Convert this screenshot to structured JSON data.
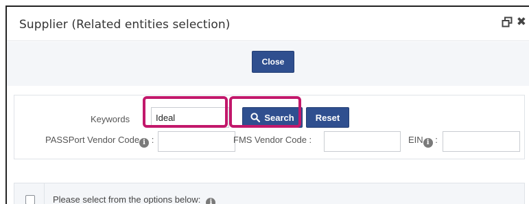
{
  "dialog": {
    "title": "Supplier (Related entities selection)",
    "restore_icon": "restore-window-icon",
    "close_icon": "close-x-icon",
    "close_glyph": "✖"
  },
  "top_bar": {
    "close_label": "Close"
  },
  "search": {
    "keywords_label": "Keywords",
    "keywords_value": "Ideal",
    "search_label": "Search",
    "reset_label": "Reset",
    "passport_label": "PASSPort Vendor Code",
    "fms_label": "FMS Vendor Code :",
    "ein_label": "EIN",
    "label_colon": ":",
    "info_glyph": "i"
  },
  "options": {
    "prompt": "Please select from the options below:"
  },
  "colors": {
    "primary_button": "#2f4f8f",
    "highlight": "#c2186b",
    "panel_bg": "#f4f6f9"
  }
}
